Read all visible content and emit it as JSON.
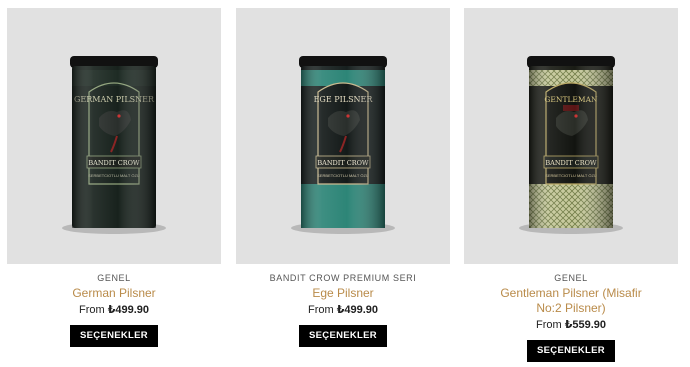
{
  "products": [
    {
      "category": "GENEL",
      "title": "German Pilsner",
      "price_prefix": "From",
      "price": "₺499.90",
      "button_label": "SEÇENEKLER",
      "label_text": "GERMAN PILSNER",
      "brand": "BANDIT CROW",
      "tagline": "SERBETCIOTLU MALT ÖZÜ",
      "icon": "crow-emblem",
      "colors": {
        "can": "#18221d",
        "band": "#1e2b24",
        "accent": "#8fa27a"
      }
    },
    {
      "category": "BANDIT CROW PREMIUM SERI",
      "title": "Ege Pilsner",
      "price_prefix": "From",
      "price": "₺499.90",
      "button_label": "SEÇENEKLER",
      "label_text": "EGE PILSNER",
      "brand": "BANDIT CROW",
      "tagline": "SERBETCIOTLU MALT ÖZÜ",
      "icon": "crow-emblem",
      "colors": {
        "can": "#17201f",
        "band": "#2d8577",
        "accent": "#c9b98c"
      }
    },
    {
      "category": "GENEL",
      "title": "Gentleman Pilsner (Misafir No:2 Pilsner)",
      "price_prefix": "From",
      "price": "₺559.90",
      "button_label": "SEÇENEKLER",
      "label_text": "GENTLEMAN",
      "brand": "BANDIT CROW",
      "tagline": "SERBETCIOTLU MALT ÖZÜ",
      "icon": "crow-emblem",
      "colors": {
        "can": "#1a1c15",
        "band": "#c5c89a",
        "accent": "#b9a761"
      }
    }
  ]
}
